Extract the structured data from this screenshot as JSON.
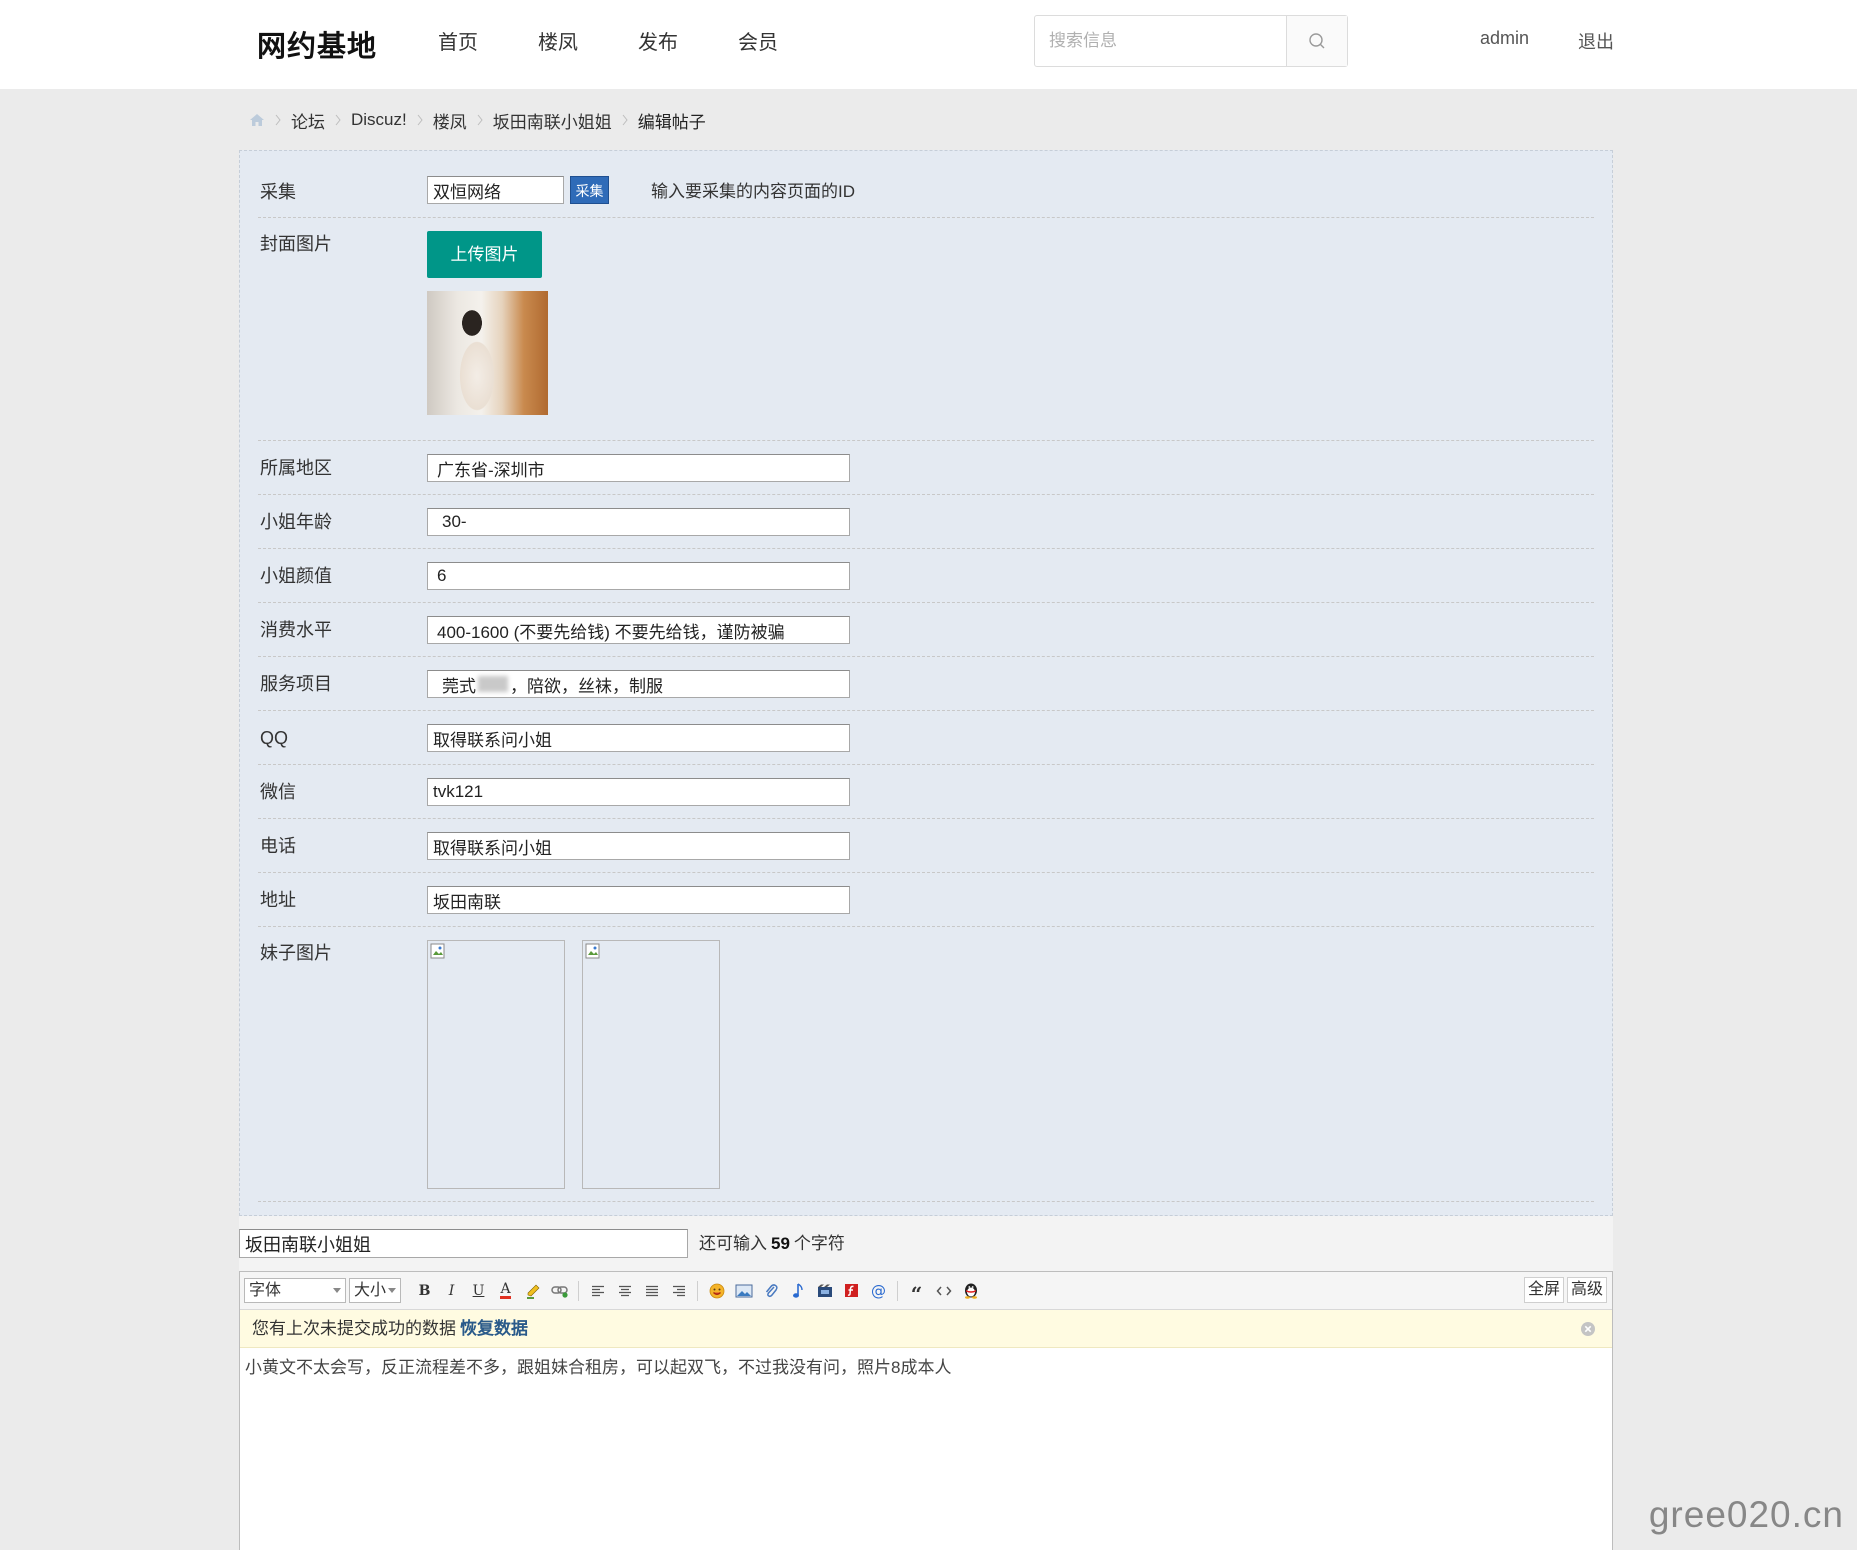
{
  "header": {
    "logo": "网约基地",
    "nav": [
      {
        "label": "首页"
      },
      {
        "label": "楼凤"
      },
      {
        "label": "发布"
      },
      {
        "label": "会员"
      }
    ],
    "search": {
      "placeholder": "搜索信息",
      "value": ""
    },
    "user": "admin",
    "logout": "退出"
  },
  "breadcrumb": [
    "论坛",
    "Discuz!",
    "楼凤",
    "坂田南联小姐姐",
    "编辑帖子"
  ],
  "form": {
    "collect": {
      "label": "采集",
      "value": "双恒网络",
      "button": "采集",
      "hint": "输入要采集的内容页面的ID"
    },
    "cover": {
      "label": "封面图片",
      "button": "上传图片"
    },
    "region": {
      "label": "所属地区",
      "value": "广东省-深圳市"
    },
    "age": {
      "label": "小姐年龄",
      "value": "30-"
    },
    "looks": {
      "label": "小姐颜值",
      "value": "6"
    },
    "price": {
      "label": "消费水平",
      "value": "400-1600 (不要先给钱) 不要先给钱，谨防被骗"
    },
    "services": {
      "label": "服务项目",
      "value_prefix": "莞式",
      "value_suffix": "，陪欲，丝袜，制服"
    },
    "qq": {
      "label": "QQ",
      "value": "取得联系问小姐"
    },
    "wechat": {
      "label": "微信",
      "value": "tvk121"
    },
    "phone": {
      "label": "电话",
      "value": "取得联系问小姐"
    },
    "address": {
      "label": "地址",
      "value": "坂田南联"
    },
    "photos": {
      "label": "妹子图片"
    }
  },
  "subject": {
    "value": "坂田南联小姐姐",
    "remain_prefix": "还可输入",
    "remain_count": "59",
    "remain_suffix": "个字符"
  },
  "editor": {
    "font_select": "字体",
    "size_select": "大小",
    "glyphs": {
      "bold": "B",
      "italic": "I",
      "underline": "U",
      "font_color": "A",
      "at": "@",
      "quote": "“"
    },
    "toolbar_icons": [
      "bold-icon",
      "italic-icon",
      "underline-icon",
      "font-color-icon",
      "highlight-icon",
      "link-icon",
      "align-left-icon",
      "align-center-icon",
      "align-justify-icon",
      "align-right-icon",
      "emoji-icon",
      "image-icon",
      "attachment-icon",
      "music-icon",
      "video-icon",
      "flash-icon",
      "at-icon",
      "quote-icon",
      "code-icon",
      "qq-icon"
    ],
    "fullscreen": "全屏",
    "advanced": "高级",
    "notice": "您有上次未提交成功的数据",
    "restore": "恢复数据",
    "content": "小黄文不太会写，反正流程差不多，跟姐妹合租房，可以起双飞，不过我没有问，照片8成本人"
  },
  "watermark": "gree020.cn",
  "theme": {
    "upload_button": "#009688",
    "collect_button": "#2f6bb8",
    "restore_link": "#2a5a8a",
    "notice_bg": "#fffbe1",
    "form_bg": "#e4eaf2"
  }
}
